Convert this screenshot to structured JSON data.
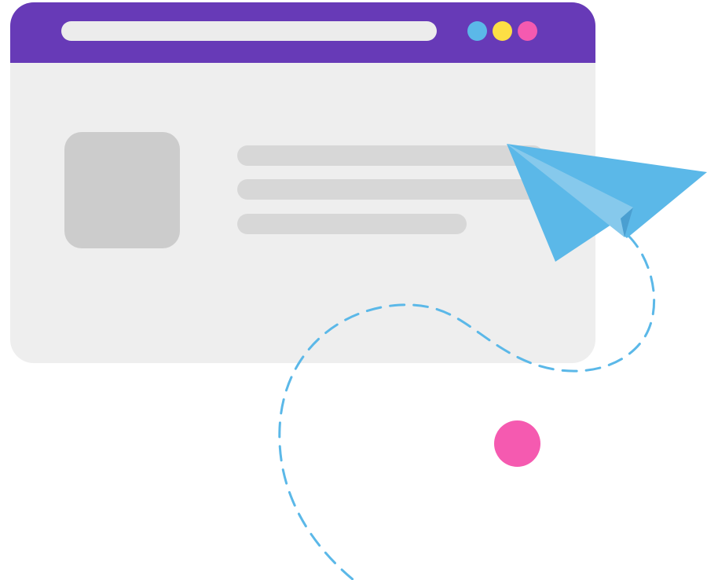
{
  "colors": {
    "titlebar": "#673ab7",
    "window_body": "#eeeeee",
    "address_bar": "#ececec",
    "image_placeholder": "#cccccc",
    "text_line": "#d7d7d7",
    "window_dot_blue": "#5bb8e8",
    "window_dot_yellow": "#fddf45",
    "window_dot_pink": "#f55ab0",
    "plane_main": "#5bb8e8",
    "plane_fold": "#86c9ec",
    "plane_shadow": "#4a9fd1",
    "flight_path": "#5bb8e8",
    "decor_circle": "#f55ab0"
  },
  "icons": {
    "plane": "paper-plane-icon",
    "placeholder": "image-placeholder"
  },
  "browser": {
    "address_bar": {
      "value": ""
    },
    "window_controls": [
      "blue",
      "yellow",
      "pink"
    ],
    "content_lines": 3
  },
  "decor": {
    "flight_path_style": "dashed",
    "circle": "pink"
  }
}
